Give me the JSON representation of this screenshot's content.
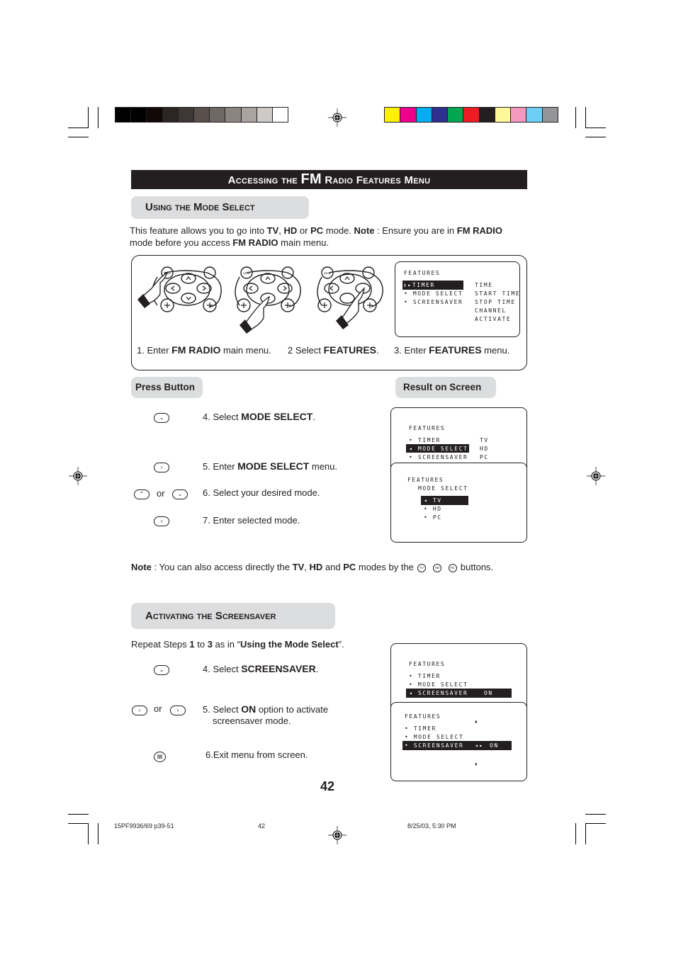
{
  "print_marks": {
    "gray_swatches": [
      "#000000",
      "#000000",
      "#120807",
      "#2b2624",
      "#3d3835",
      "#59504c",
      "#6f6763",
      "#8c8480",
      "#aaa39f",
      "#cecac8",
      "#ffffff"
    ],
    "color_swatches": [
      "#fff100",
      "#ec008c",
      "#00aeef",
      "#2e3192",
      "#00a651",
      "#ed1c24",
      "#231f20",
      "#fff799",
      "#f49ac1",
      "#6dcff6",
      "#939598"
    ]
  },
  "title": {
    "prefix": "Accessing the ",
    "em": "FM",
    "suffix": " Radio Features Menu"
  },
  "mode_select": {
    "heading": "Using the Mode Select",
    "intro": {
      "t1": "This feature allows you to go into ",
      "b1": "TV",
      "t2": ",  ",
      "b2": "HD",
      "t3": " or ",
      "b3": "PC",
      "t4": " mode. ",
      "b4": "Note",
      "t5": " :  Ensure you are in ",
      "b5": "FM RADIO",
      "t6": " mode before you access ",
      "b6": "FM RADIO",
      "t7": " main menu."
    },
    "remote_labels": {
      "menu": "MENU",
      "osd": "OSD"
    },
    "steps_top": [
      {
        "pre": "1. Enter ",
        "bold": "FM RADIO",
        "post": " main menu."
      },
      {
        "pre": "2  Select ",
        "bold": "FEATURES",
        "post": "."
      },
      {
        "pre": "3.  Enter ",
        "bold": "FEATURES",
        "post": " menu."
      }
    ],
    "osd_features": {
      "title": "FEATURES",
      "items": [
        "TIMER",
        "MODE SELECT",
        "SCREENSAVER"
      ],
      "selected": "TIMER",
      "sub": [
        "TIME",
        "START TIME",
        "STOP TIME",
        "CHANNEL",
        "ACTIVATE"
      ]
    },
    "press_button_label": "Press Button",
    "result_label": "Result on Screen",
    "or_label": "or",
    "steps": [
      {
        "buttons": [
          "down"
        ],
        "pre": "4. Select ",
        "bold": "MODE SELECT",
        "post": "."
      },
      {
        "buttons": [
          "right"
        ],
        "pre": "5. Enter ",
        "bold": "MODE SELECT",
        "post": " menu."
      },
      {
        "buttons": [
          "up",
          "down"
        ],
        "pre": "6. Select your desired mode.",
        "bold": "",
        "post": ""
      },
      {
        "buttons": [
          "right"
        ],
        "pre": "7. Enter selected mode.",
        "bold": "",
        "post": ""
      }
    ],
    "osd_result_1": {
      "title": "FEATURES",
      "items": [
        "TIMER",
        "MODE SELECT",
        "SCREENSAVER"
      ],
      "selected": "MODE SELECT",
      "options": [
        "TV",
        "HD",
        "PC"
      ]
    },
    "osd_result_2": {
      "title": "FEATURES",
      "subtitle": "MODE SELECT",
      "options": [
        "TV",
        "HD",
        "PC"
      ],
      "selected": "TV"
    },
    "note": {
      "b1": "Note",
      "t1": " : You can also access directly the ",
      "b2": "TV",
      "t2": ", ",
      "b3": "HD",
      "t3": " and ",
      "b4": "PC",
      "t4": " modes by the",
      "buttons": [
        "TV",
        "HD",
        "PC"
      ],
      "t5": "buttons."
    }
  },
  "screensaver": {
    "heading": "Activating the Screensaver",
    "repeat": {
      "t1": "Repeat Steps ",
      "b1": "1",
      "t2": " to ",
      "b2": "3",
      "t3": " as in “",
      "b3": "Using the Mode Select",
      "t4": "”."
    },
    "or_label": "or",
    "steps": [
      {
        "buttons": [
          "down"
        ],
        "pre": "4. Select ",
        "bold": "SCREENSAVER",
        "post": "."
      },
      {
        "buttons": [
          "right",
          "left"
        ],
        "pre": "5. Select ",
        "bold": "ON",
        "post": " option to activate",
        "line2": "screensaver mode."
      },
      {
        "buttons": [
          "osd"
        ],
        "pre": "6.Exit menu from screen.",
        "bold": "",
        "post": ""
      }
    ],
    "osd_result_1": {
      "title": "FEATURES",
      "items": [
        "TIMER",
        "MODE SELECT",
        "SCREENSAVER"
      ],
      "selected": "SCREENSAVER",
      "value": "ON"
    },
    "osd_result_2": {
      "title": "FEATURES",
      "items": [
        "TIMER",
        "MODE SELECT",
        "SCREENSAVER"
      ],
      "selected": "SCREENSAVER",
      "value": "ON"
    }
  },
  "page_number": "42",
  "footer": {
    "file": "15PF9936/69 p39-51",
    "page": "42",
    "date": "8/25/03, 5:30 PM"
  }
}
